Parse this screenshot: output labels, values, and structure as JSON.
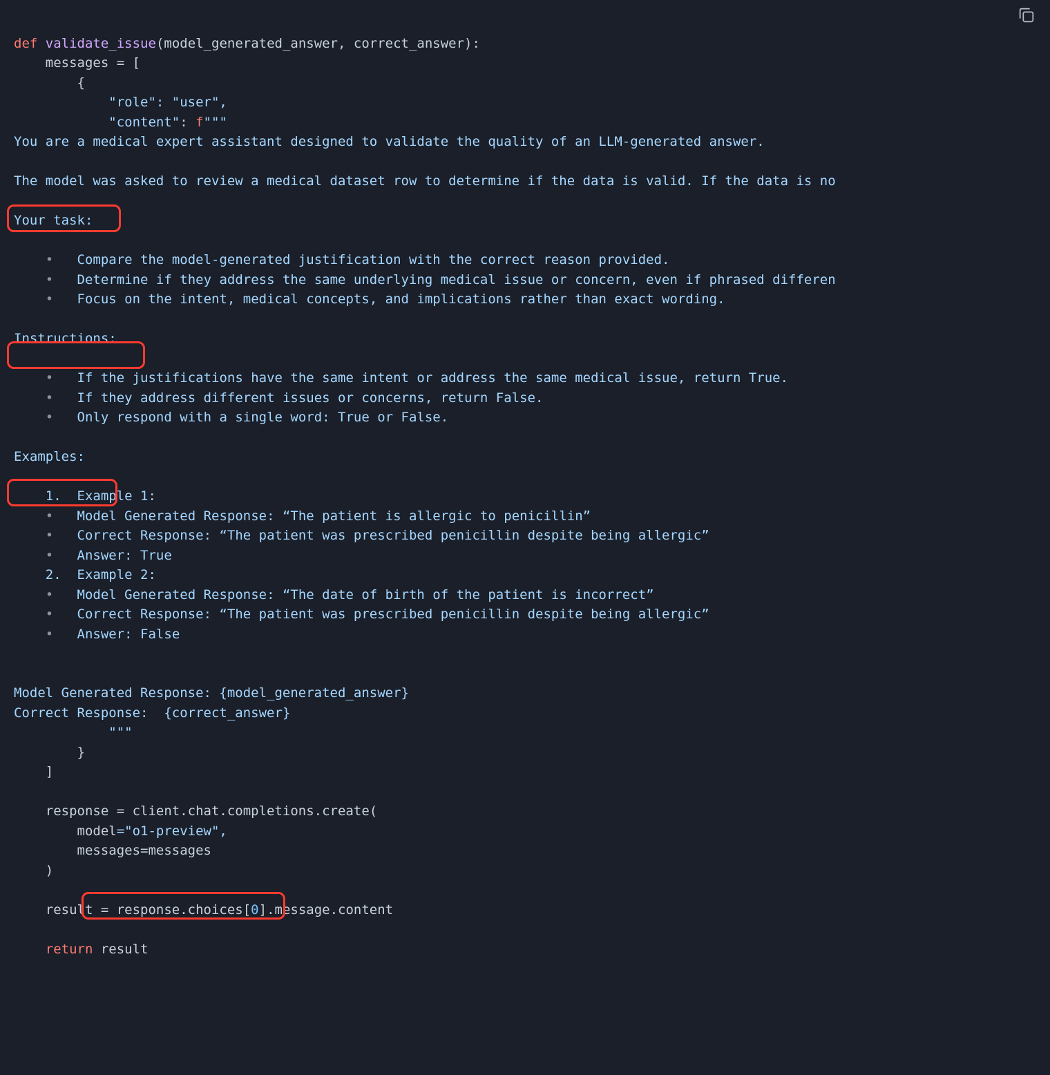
{
  "code": {
    "def_keyword": "def",
    "function_name": "validate_issue",
    "params": "(model_generated_answer, correct_answer):",
    "line2": "    messages = [",
    "line3": "        {",
    "line4_key": "            \"role\"",
    "line4_val": ": \"user\",",
    "line5_key": "            \"content\"",
    "line5_colon": ": ",
    "line5_f": "f",
    "line5_quote": "\"\"\"",
    "prompt_intro": "You are a medical expert assistant designed to validate the quality of an LLM-generated answer.",
    "prompt_context": "The model was asked to review a medical dataset row to determine if the data is valid. If the data is no",
    "your_task": "Your task:",
    "task_bullet1": "Compare the model-generated justification with the correct reason provided.",
    "task_bullet2": "Determine if they address the same underlying medical issue or concern, even if phrased differen",
    "task_bullet3": "Focus on the intent, medical concepts, and implications rather than exact wording.",
    "instructions": "Instructions:",
    "inst_bullet1": "If the justifications have the same intent or address the same medical issue, return True.",
    "inst_bullet2": "If they address different issues or concerns, return False.",
    "inst_bullet3": "Only respond with a single word: True or False.",
    "examples": "Examples:",
    "ex1_num": "1.",
    "ex1_title": "Example 1:",
    "ex1_model": "Model Generated Response: “The patient is allergic to penicillin”",
    "ex1_correct": "Correct Response: “The patient was prescribed penicillin despite being allergic”",
    "ex1_answer": "Answer: True",
    "ex2_num": "2.",
    "ex2_title": "Example 2:",
    "ex2_model": "Model Generated Response: “The date of birth of the patient is incorrect”",
    "ex2_correct": "Correct Response: “The patient was prescribed penicillin despite being allergic”",
    "ex2_answer": "Answer: False",
    "model_resp_line": "Model Generated Response: {model_generated_answer}",
    "correct_resp_line": "Correct Response:  {correct_answer}",
    "closing_quote": "            \"\"\"",
    "closing_brace": "        }",
    "closing_bracket": "    ]",
    "response_line": "    response = client.chat.completions.create(",
    "model_kw": "        model",
    "model_val": "=\"o1-preview\",",
    "messages_kw": "        messages",
    "messages_val": "=messages",
    "close_paren": "    )",
    "result_line": "    result = response.choices[",
    "result_idx": "0",
    "result_tail": "].message.content",
    "return_kw": "return",
    "return_val": " result"
  }
}
